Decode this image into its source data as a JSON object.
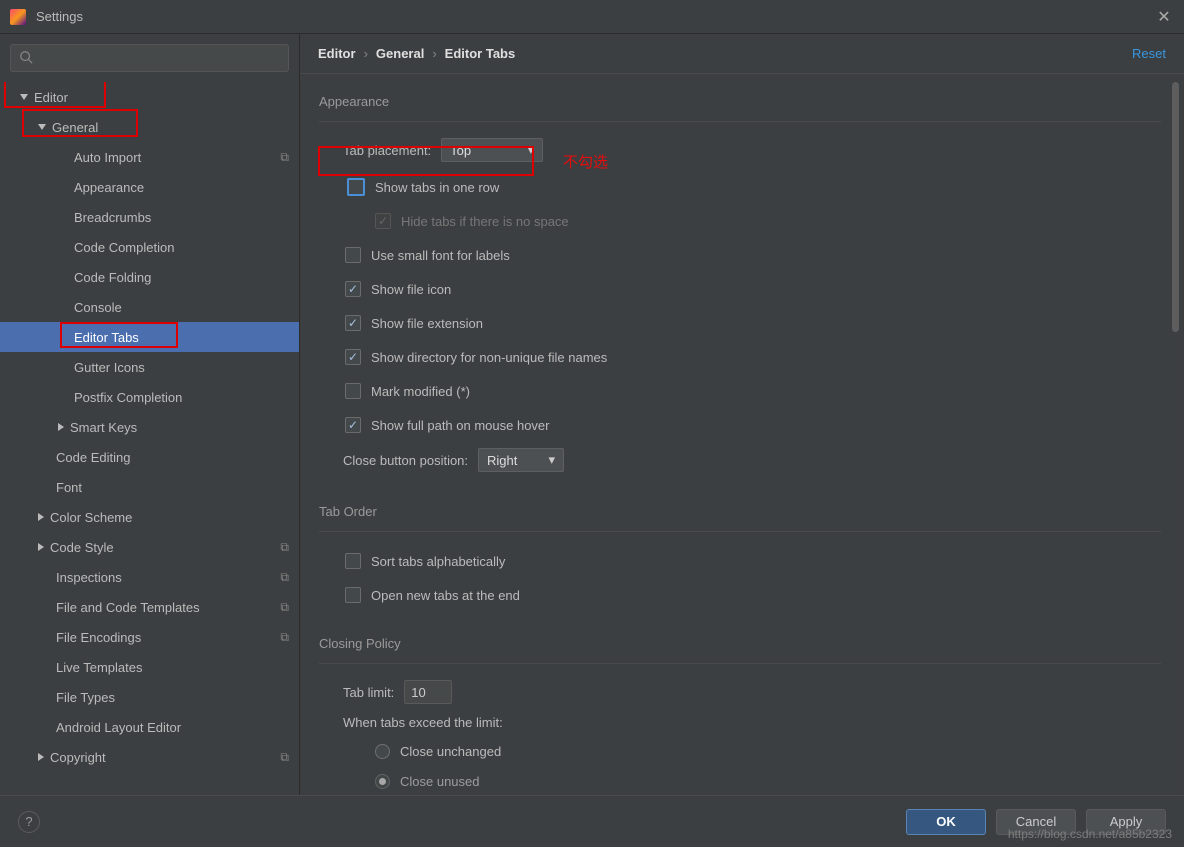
{
  "window": {
    "title": "Settings"
  },
  "search": {
    "placeholder": ""
  },
  "tree": {
    "editor": "Editor",
    "general": "General",
    "items_general": [
      "Auto Import",
      "Appearance",
      "Breadcrumbs",
      "Code Completion",
      "Code Folding",
      "Console",
      "Editor Tabs",
      "Gutter Icons",
      "Postfix Completion"
    ],
    "smart_keys": "Smart Keys",
    "code_editing": "Code Editing",
    "font": "Font",
    "color_scheme": "Color Scheme",
    "code_style": "Code Style",
    "inspections": "Inspections",
    "file_and_code_templates": "File and Code Templates",
    "file_encodings": "File Encodings",
    "live_templates": "Live Templates",
    "file_types": "File Types",
    "android_layout_editor": "Android Layout Editor",
    "copyright": "Copyright"
  },
  "breadcrumb": {
    "p0": "Editor",
    "p1": "General",
    "p2": "Editor Tabs",
    "reset": "Reset"
  },
  "annotation": {
    "dont_check": "不勾选"
  },
  "appearance": {
    "title": "Appearance",
    "tab_placement_label": "Tab placement:",
    "tab_placement_value": "Top",
    "show_tabs_one_row": "Show tabs in one row",
    "hide_tabs_no_space": "Hide tabs if there is no space",
    "use_small_font": "Use small font for labels",
    "show_file_icon": "Show file icon",
    "show_file_ext": "Show file extension",
    "show_dir_nonunique": "Show directory for non-unique file names",
    "mark_modified": "Mark modified (*)",
    "show_full_path_hover": "Show full path on mouse hover",
    "close_button_pos_label": "Close button position:",
    "close_button_pos_value": "Right"
  },
  "tab_order": {
    "title": "Tab Order",
    "sort_alpha": "Sort tabs alphabetically",
    "open_new_end": "Open new tabs at the end"
  },
  "closing": {
    "title": "Closing Policy",
    "tab_limit_label": "Tab limit:",
    "tab_limit_value": "10",
    "exceed_label": "When tabs exceed the limit:",
    "close_unchanged": "Close unchanged",
    "close_unused": "Close unused"
  },
  "buttons": {
    "ok": "OK",
    "cancel": "Cancel",
    "apply": "Apply"
  },
  "watermark": "https://blog.csdn.net/a85b2323"
}
